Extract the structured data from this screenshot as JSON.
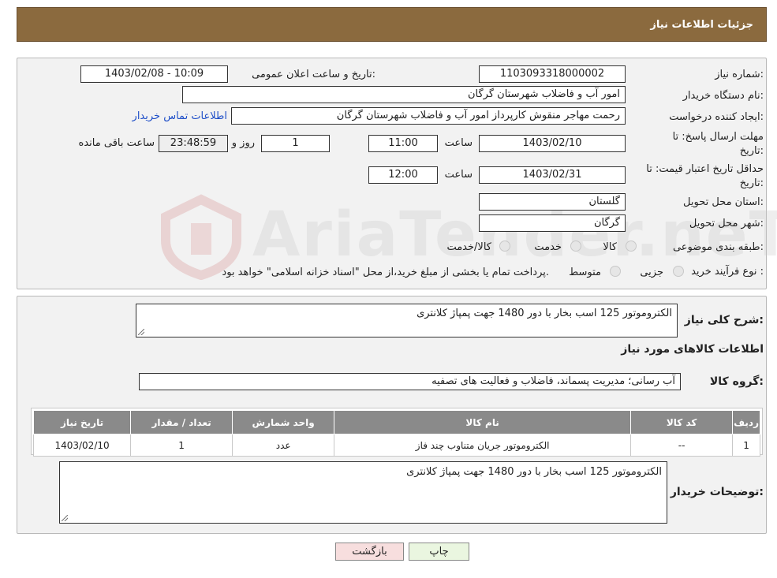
{
  "header": {
    "title": "جزئیات اطلاعات نیاز"
  },
  "form": {
    "need_number": {
      "label": "شماره نیاز:",
      "value": "1103093318000002"
    },
    "announce_datetime": {
      "label": "تاریخ و ساعت اعلان عمومی:",
      "value": "1403/02/08 - 10:09"
    },
    "buyer_org": {
      "label": "نام دستگاه خریدار:",
      "value": "امور آب و فاضلاب شهرستان گرگان"
    },
    "requester": {
      "label": "ایجاد کننده درخواست:",
      "value": "رحمت مهاجر منقوش کارپرداز امور آب و فاضلاب شهرستان گرگان"
    },
    "contact_link": "اطلاعات تماس خریدار",
    "deadline": {
      "label_line1": "مهلت ارسال پاسخ: تا",
      "label_line2": "تاریخ:",
      "date": "1403/02/10",
      "time_label": "ساعت",
      "time": "11:00",
      "days": "1",
      "days_label": "روز و",
      "remaining": "23:48:59",
      "remaining_label": "ساعت باقی مانده"
    },
    "price_validity": {
      "label_line1": "حداقل تاریخ اعتبار قیمت: تا",
      "label_line2": "تاریخ:",
      "date": "1403/02/31",
      "time_label": "ساعت",
      "time": "12:00"
    },
    "province": {
      "label": "استان محل تحویل:",
      "value": "گلستان"
    },
    "city": {
      "label": "شهر محل تحویل:",
      "value": "گرگان"
    },
    "category": {
      "label": "طبقه بندی موضوعی:",
      "options": [
        "کالا",
        "خدمت",
        "کالا/خدمت"
      ]
    },
    "purchase_type": {
      "label": "نوع فرآیند خرید :",
      "options": [
        "جزیی",
        "متوسط"
      ],
      "note": "پرداخت تمام یا بخشی از مبلغ خرید،از محل \"اسناد خزانه اسلامی\" خواهد بود."
    }
  },
  "details": {
    "summary_label": "شرح کلی نیاز:",
    "summary_value": "الکتروموتور 125 اسب بخار با دور 1480 جهت پمپاژ کلانتری",
    "goods_section_title": "اطلاعات کالاهای مورد نیاز",
    "goods_group_label": "گروه کالا:",
    "goods_group_value": "آب رسانی؛ مدیریت پسماند، فاضلاب و فعالیت های تصفیه",
    "table": {
      "headers": [
        "ردیف",
        "کد کالا",
        "نام کالا",
        "واحد شمارش",
        "تعداد / مقدار",
        "تاریخ نیاز"
      ],
      "rows": [
        [
          "1",
          "--",
          "الکتروموتور جریان متناوب چند فاز",
          "عدد",
          "1",
          "1403/02/10"
        ]
      ]
    },
    "buyer_notes_label": "توضیحات خریدار:",
    "buyer_notes_value": "الکتروموتور 125 اسب بخار با دور 1480 جهت پمپاژ کلانتری"
  },
  "buttons": {
    "print": "چاپ",
    "back": "بازگشت"
  },
  "watermark": {
    "text": "AriaTender.neT"
  },
  "colors": {
    "header_bg": "#8b6a3e",
    "link": "#1f4fc8",
    "table_header": "#8a8a8a",
    "back_button": "#f7dede",
    "print_button": "#eaf6e0"
  }
}
